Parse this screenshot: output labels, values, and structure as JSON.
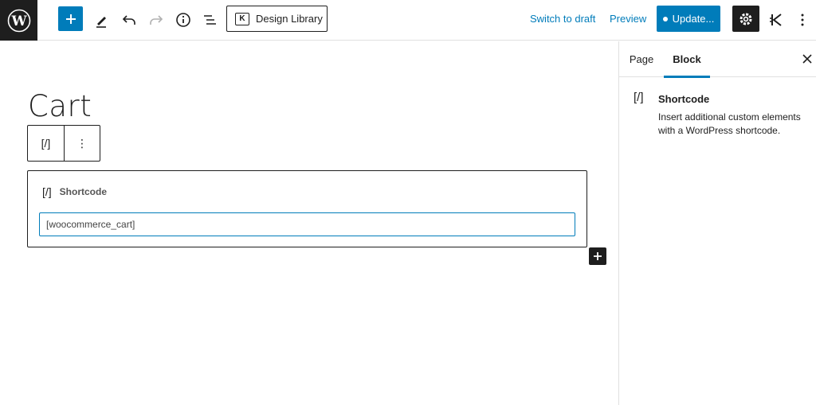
{
  "toolbar": {
    "design_library_label": "Design Library",
    "switch_to_draft_label": "Switch to draft",
    "preview_label": "Preview",
    "update_label": "Update...",
    "icons": [
      "wordpress-logo",
      "plus-icon",
      "pencil-icon",
      "undo-icon",
      "redo-icon",
      "info-icon",
      "list-view-icon",
      "gear-icon",
      "kadence-icon",
      "more-vertical-icon"
    ]
  },
  "editor": {
    "page_title": "Cart",
    "block_toolbar": {
      "shortcode_glyph": "[/]",
      "options_glyph": "⋮"
    },
    "shortcode_block": {
      "label": "Shortcode",
      "glyph": "[/]",
      "value": "[woocommerce_cart]"
    }
  },
  "sidebar": {
    "tabs": [
      {
        "label": "Page",
        "active": false
      },
      {
        "label": "Block",
        "active": true
      }
    ],
    "block_card": {
      "glyph": "[/]",
      "title": "Shortcode",
      "description": "Insert additional custom elements with a WordPress shortcode."
    }
  },
  "colors": {
    "accent": "#007cba",
    "dark": "#1e1e1e",
    "border": "#e0e0e0"
  }
}
